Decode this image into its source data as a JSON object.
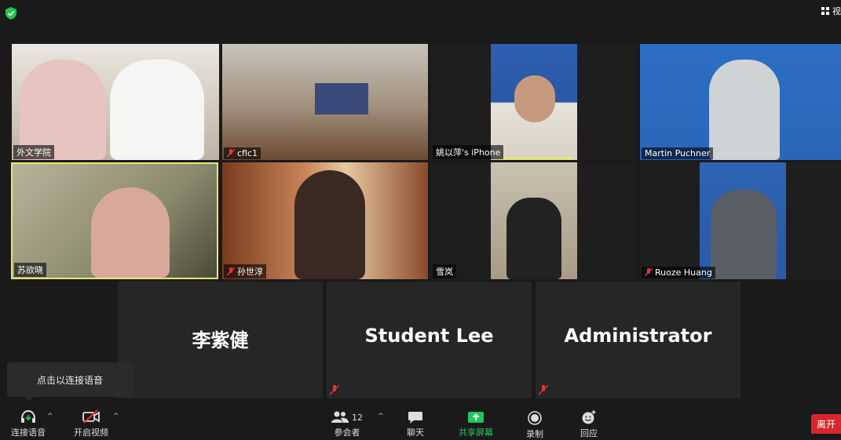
{
  "topbar": {
    "view_label": "视"
  },
  "participants": [
    {
      "name": "外文学院",
      "muted": false
    },
    {
      "name": "cflc1",
      "muted": true
    },
    {
      "name": "姚以萍's iPhone",
      "muted": false
    },
    {
      "name": "Martin Puchner",
      "muted": false
    },
    {
      "name": "苏欲晓",
      "muted": false
    },
    {
      "name": "孙世淳",
      "muted": true
    },
    {
      "name": "雪岚",
      "muted": false
    },
    {
      "name": "Ruoze Huang",
      "muted": true
    }
  ],
  "name_tiles": [
    {
      "name": "李紫健"
    },
    {
      "name": "Student Lee"
    },
    {
      "name": "Administrator"
    }
  ],
  "tooltip": {
    "text": "点击以连接语音"
  },
  "toolbar": {
    "audio_label": "连接语音",
    "video_label": "开启视频",
    "participants_label": "参会者",
    "participants_count": "12",
    "chat_label": "聊天",
    "share_label": "共享屏幕",
    "record_label": "录制",
    "reactions_label": "回应",
    "leave_label": "离开"
  },
  "colors": {
    "share_green": "#22c55e",
    "leave_red": "#d9262b",
    "active_speaker": "#e8e86a"
  }
}
